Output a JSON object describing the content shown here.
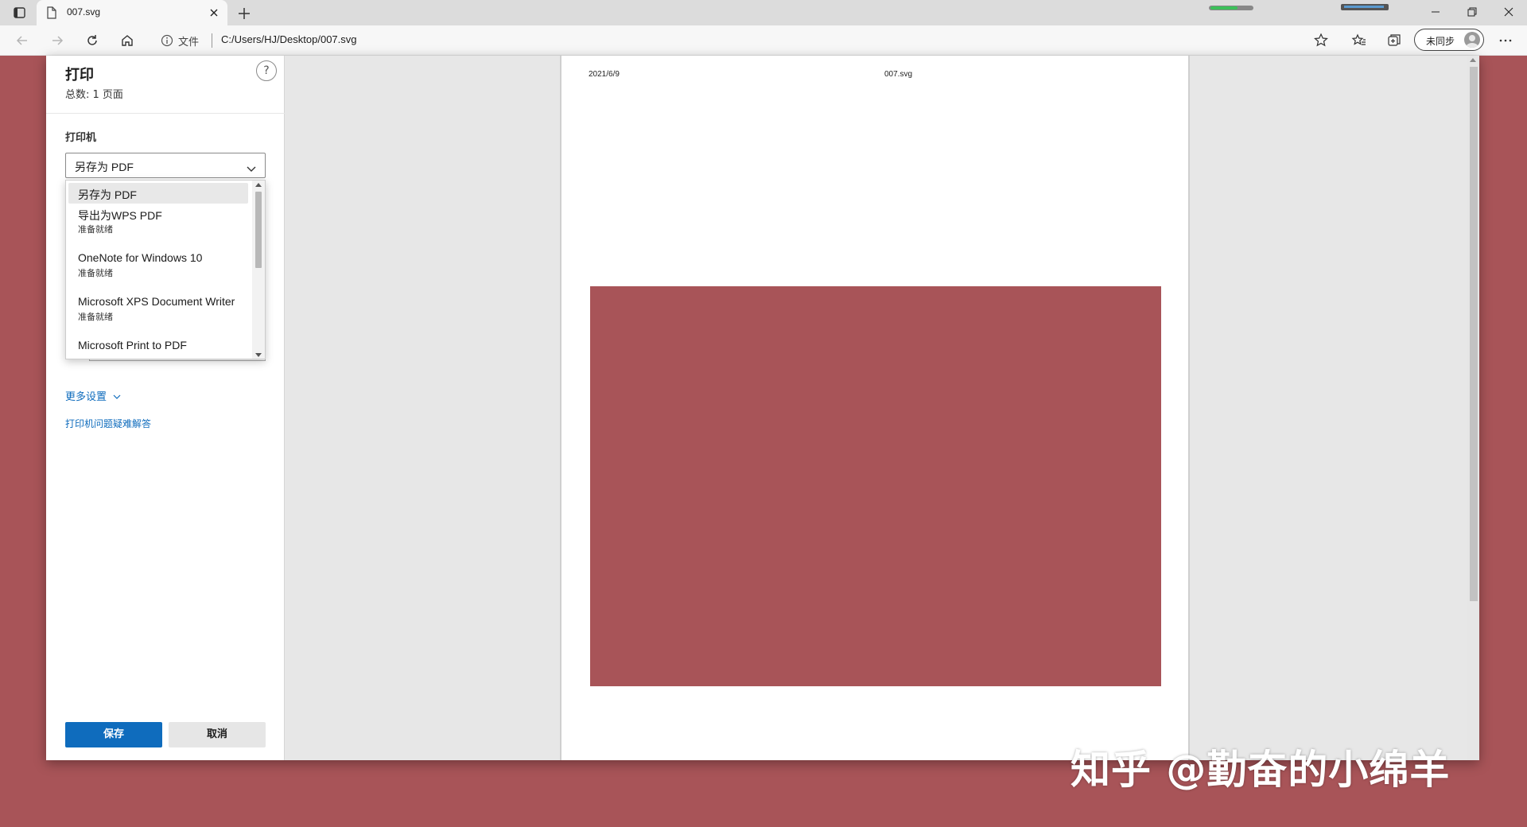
{
  "browser": {
    "tab": {
      "title": "007.svg"
    },
    "address": {
      "scheme_label": "文件",
      "url": "C:/Users/HJ/Desktop/007.svg"
    },
    "profile": {
      "sync_label": "未同步"
    }
  },
  "print": {
    "title": "打印",
    "total_pages": "总数: 1 页面",
    "help_symbol": "?",
    "printer_label": "打印机",
    "printer_selected": "另存为 PDF",
    "printers": [
      {
        "name": "另存为 PDF",
        "status": ""
      },
      {
        "name": "导出为WPS PDF",
        "status": "准备就绪"
      },
      {
        "name": "OneNote for Windows 10",
        "status": "准备就绪"
      },
      {
        "name": "Microsoft XPS Document Writer",
        "status": "准备就绪"
      },
      {
        "name": "Microsoft Print to PDF",
        "status": ""
      }
    ],
    "more_settings": "更多设置",
    "troubleshoot": "打印机问题疑难解答",
    "save": "保存",
    "cancel": "取消"
  },
  "preview": {
    "header_date": "2021/6/9",
    "header_file": "007.svg",
    "content_color": "#a85458"
  },
  "watermark": "知乎 @勤奋的小绵羊",
  "colors": {
    "accent": "#0f6cbd",
    "background": "#a85458"
  }
}
